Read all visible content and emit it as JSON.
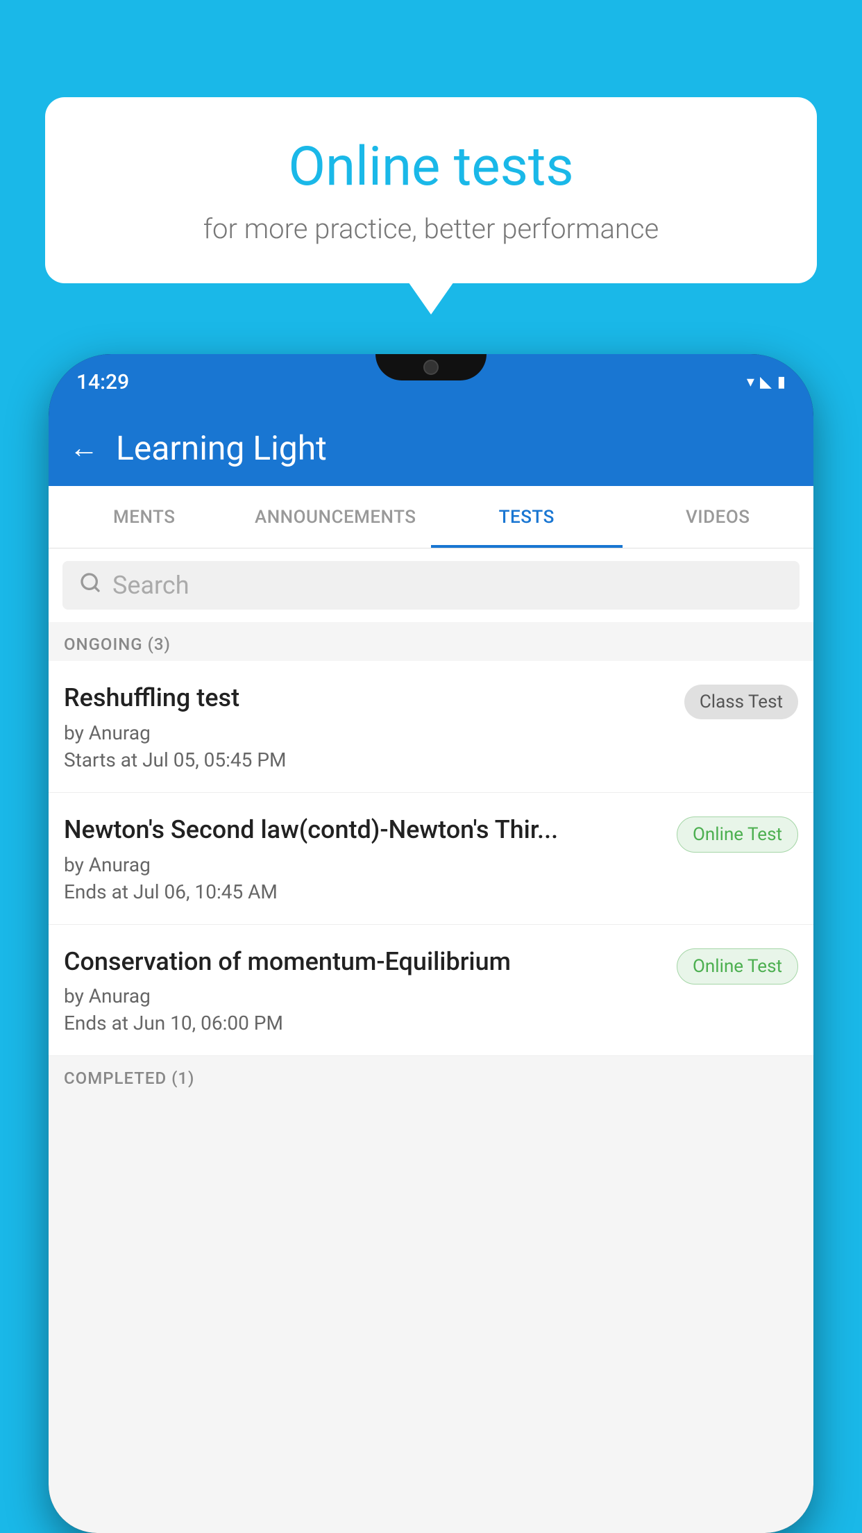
{
  "background": {
    "color": "#1ab8e8"
  },
  "speech_bubble": {
    "title": "Online tests",
    "subtitle": "for more practice, better performance"
  },
  "phone": {
    "status_bar": {
      "time": "14:29",
      "wifi": "wifi",
      "signal": "signal",
      "battery": "battery"
    },
    "app_bar": {
      "back_icon": "←",
      "title": "Learning Light"
    },
    "tabs": [
      {
        "label": "MENTS",
        "active": false
      },
      {
        "label": "ANNOUNCEMENTS",
        "active": false
      },
      {
        "label": "TESTS",
        "active": true
      },
      {
        "label": "VIDEOS",
        "active": false
      }
    ],
    "search": {
      "placeholder": "Search",
      "icon": "🔍"
    },
    "ongoing_section": {
      "header": "ONGOING (3)",
      "items": [
        {
          "title": "Reshuffling test",
          "by": "by Anurag",
          "date": "Starts at  Jul 05, 05:45 PM",
          "badge": "Class Test",
          "badge_type": "class"
        },
        {
          "title": "Newton's Second law(contd)-Newton's Thir...",
          "by": "by Anurag",
          "date": "Ends at  Jul 06, 10:45 AM",
          "badge": "Online Test",
          "badge_type": "online"
        },
        {
          "title": "Conservation of momentum-Equilibrium",
          "by": "by Anurag",
          "date": "Ends at  Jun 10, 06:00 PM",
          "badge": "Online Test",
          "badge_type": "online"
        }
      ]
    },
    "completed_section": {
      "header": "COMPLETED (1)"
    }
  }
}
